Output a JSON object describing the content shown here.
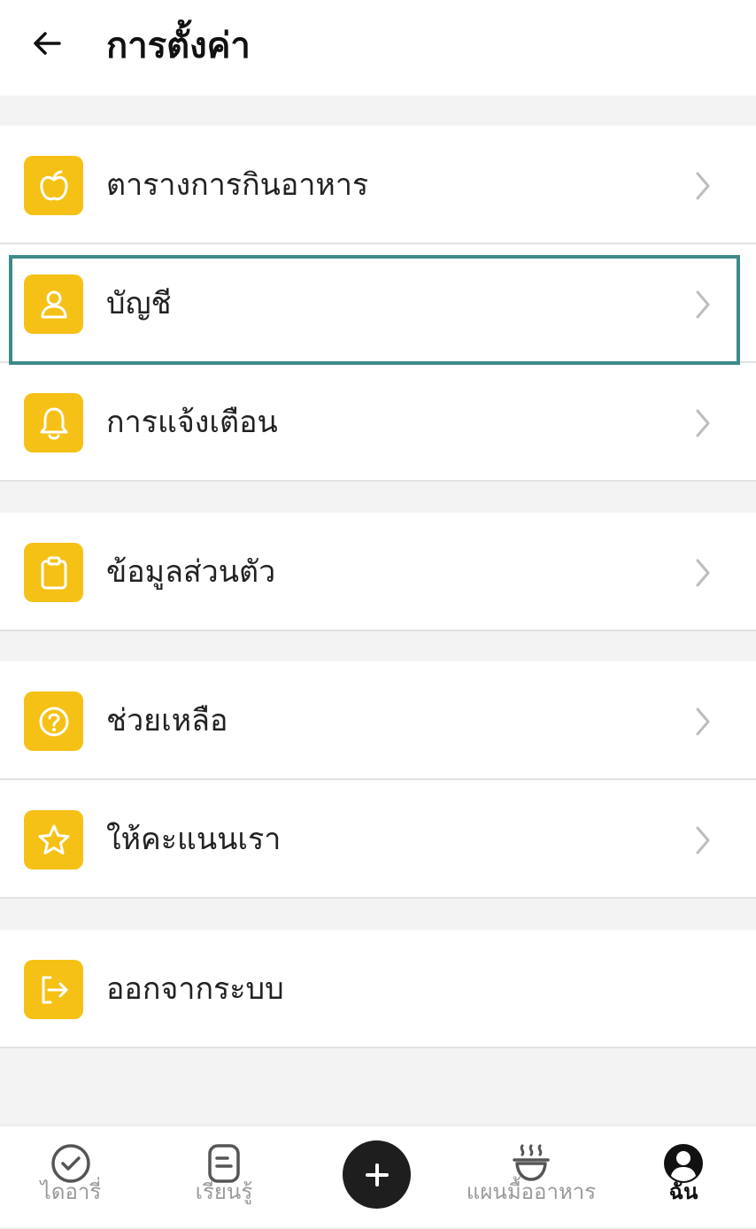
{
  "header": {
    "title": "การตั้งค่า"
  },
  "groups": [
    {
      "items": [
        {
          "label": "ตารางการกินอาหาร",
          "icon": "apple-icon"
        },
        {
          "label": "บัญชี",
          "icon": "user-icon"
        },
        {
          "label": "การแจ้งเตือน",
          "icon": "bell-icon"
        }
      ]
    },
    {
      "items": [
        {
          "label": "ข้อมูลส่วนตัว",
          "icon": "clipboard-icon"
        }
      ]
    },
    {
      "items": [
        {
          "label": "ช่วยเหลือ",
          "icon": "help-icon"
        },
        {
          "label": "ให้คะแนนเรา",
          "icon": "star-icon"
        }
      ]
    },
    {
      "items": [
        {
          "label": "ออกจากระบบ",
          "icon": "logout-icon"
        }
      ]
    }
  ],
  "nav": {
    "diary": "ไดอารี่",
    "learn": "เรียนรู้",
    "meal_plan": "แผนมื้ออาหาร",
    "me": "ฉัน"
  },
  "colors": {
    "accent": "#f5c116",
    "highlight": "#3e8a8a",
    "fab": "#1e1e1e"
  }
}
